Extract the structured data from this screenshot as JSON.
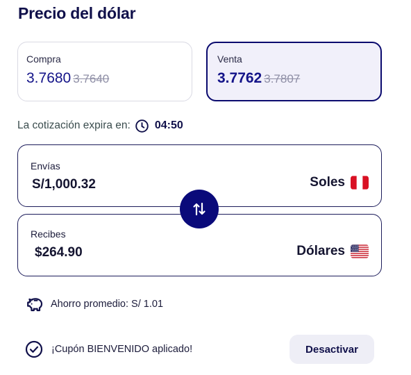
{
  "header": {
    "title": "Precio del dólar"
  },
  "rates": {
    "buy": {
      "label": "Compra",
      "current": "3.7680",
      "previous": "3.7640"
    },
    "sell": {
      "label": "Venta",
      "current": "3.7762",
      "previous": "3.7807",
      "selected": true
    }
  },
  "expiry": {
    "text": "La cotización expira en:",
    "countdown": "04:50",
    "icon": "clock-icon"
  },
  "send": {
    "label": "Envías",
    "amount": "S/1,000.32",
    "currency": "Soles",
    "flag": "peru-flag-icon"
  },
  "receive": {
    "label": "Recibes",
    "amount": "$264.90",
    "currency": "Dólares",
    "flag": "usa-flag-icon"
  },
  "swap": {
    "icon": "swap-arrows-icon"
  },
  "savings": {
    "text": "Ahorro promedio: S/ 1.01",
    "icon": "piggy-bank-icon"
  },
  "coupon": {
    "text": "¡Cupón BIENVENIDO aplicado!",
    "icon": "check-circle-icon",
    "button_label": "Desactivar"
  },
  "colors": {
    "primary": "#0a0a7a",
    "text_dark": "#10104a",
    "strike": "#8f8fa6",
    "selected_bg": "#f1f0fa",
    "button_bg": "#eeeef6"
  }
}
